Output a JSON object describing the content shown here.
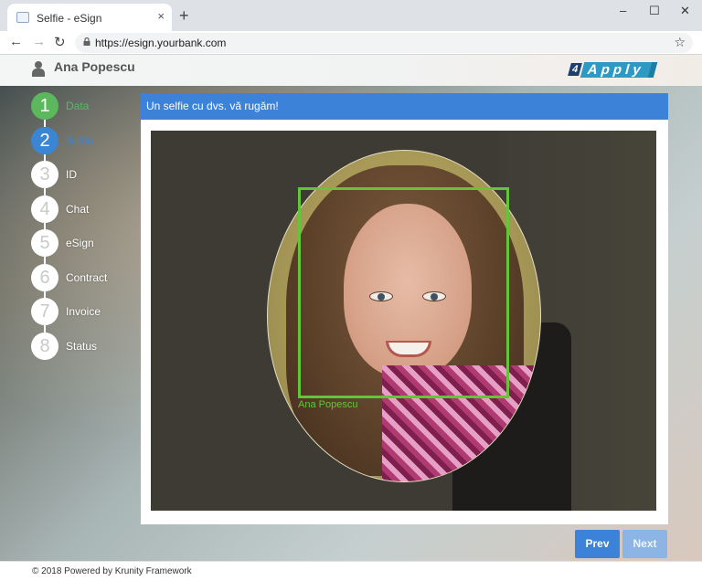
{
  "browser": {
    "tab_title": "Selfie - eSign",
    "tab_close": "×",
    "new_tab": "+",
    "url": "https://esign.yourbank.com",
    "back": "←",
    "forward": "→",
    "reload": "↻",
    "bookmark": "☆",
    "minimize": "–",
    "maximize": "☐",
    "close": "✕"
  },
  "header": {
    "user_name": "Ana Popescu",
    "logo_prefix": "4",
    "logo_word": "Apply"
  },
  "stepper": {
    "steps": [
      {
        "number": "1",
        "label": "Data",
        "state": "done"
      },
      {
        "number": "2",
        "label": "Selfie",
        "state": "active"
      },
      {
        "number": "3",
        "label": "ID",
        "state": "pending"
      },
      {
        "number": "4",
        "label": "Chat",
        "state": "pending"
      },
      {
        "number": "5",
        "label": "eSign",
        "state": "pending"
      },
      {
        "number": "6",
        "label": "Contract",
        "state": "pending"
      },
      {
        "number": "7",
        "label": "Invoice",
        "state": "pending"
      },
      {
        "number": "8",
        "label": "Status",
        "state": "pending"
      }
    ]
  },
  "panel": {
    "title": "Un selfie cu dvs. vă rugăm!",
    "detected_name": "Ana Popescu"
  },
  "buttons": {
    "prev": "Prev",
    "next": "Next"
  },
  "footer": {
    "text": "© 2018 Powered by Krunity Framework"
  },
  "colors": {
    "accent": "#3b82d8",
    "done": "#5cb85c",
    "detection": "#63c53a"
  }
}
